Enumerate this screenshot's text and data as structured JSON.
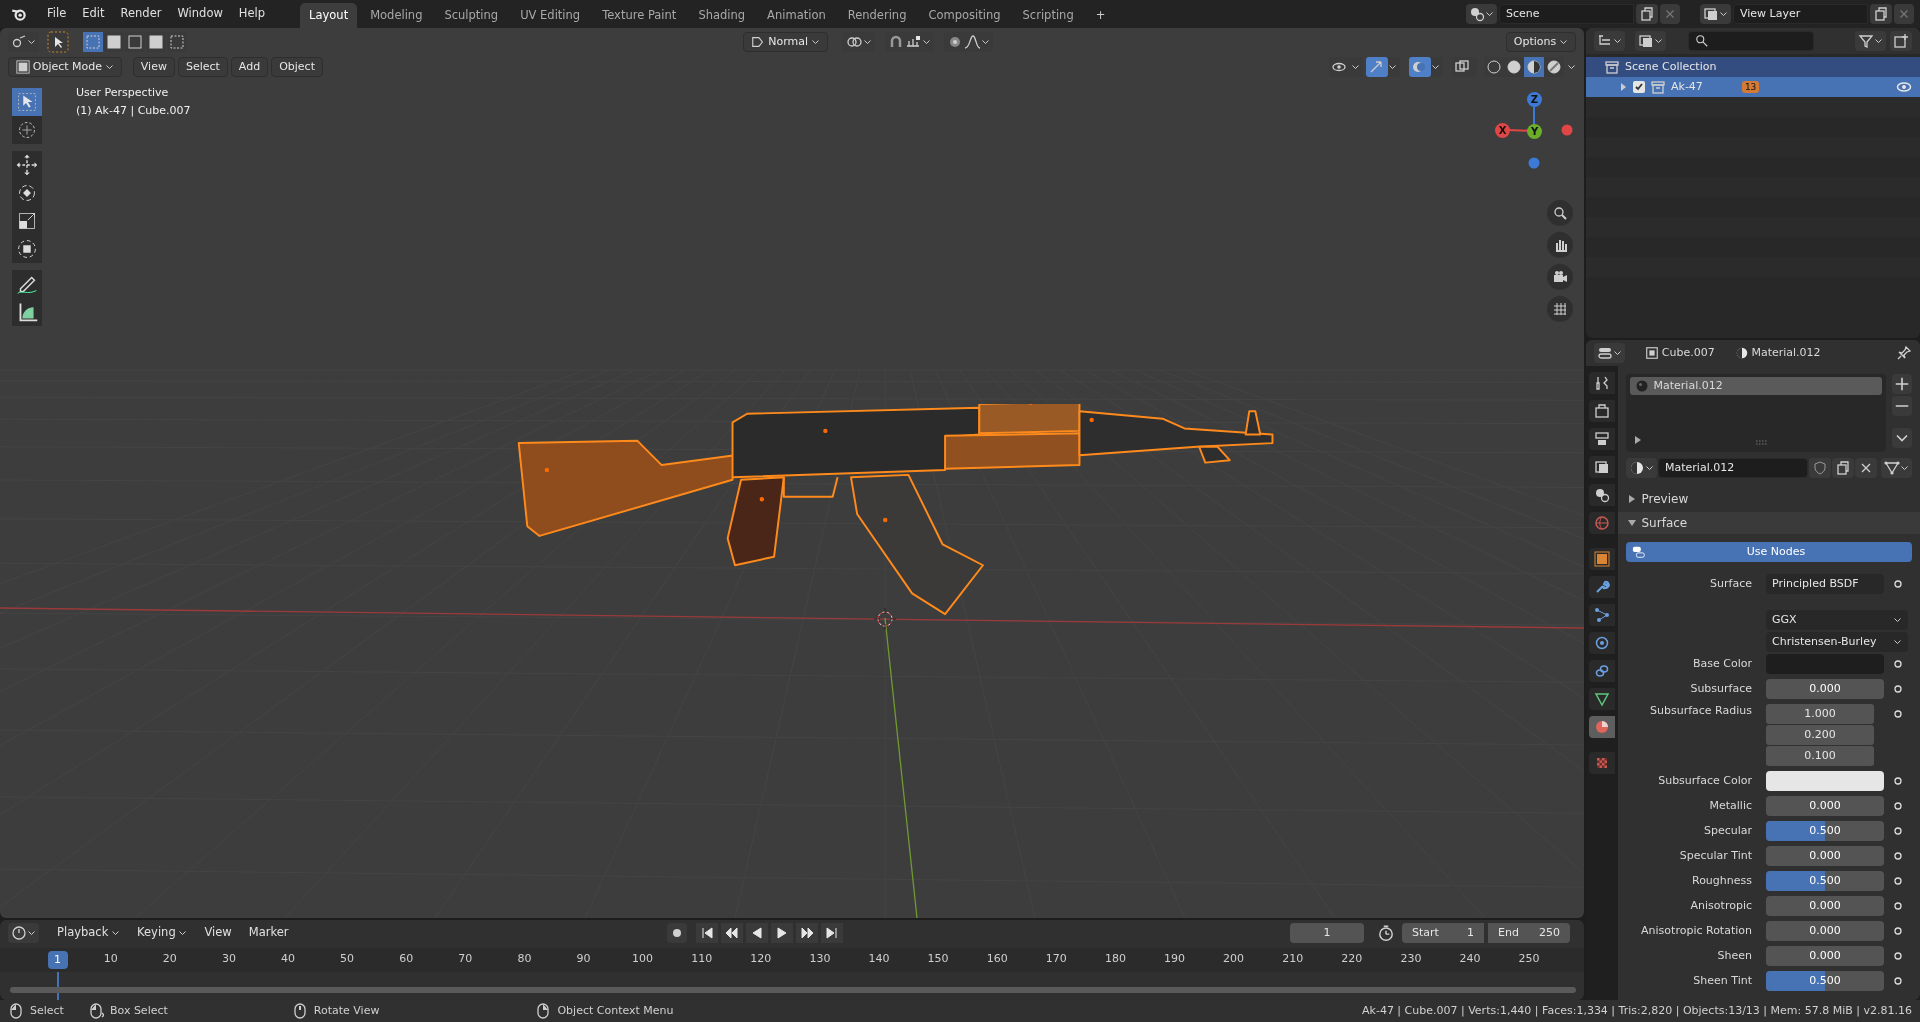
{
  "top_bar": {
    "menus": [
      "File",
      "Edit",
      "Render",
      "Window",
      "Help"
    ],
    "workspaces": [
      {
        "label": "Layout",
        "selected": true
      },
      {
        "label": "Modeling",
        "selected": false
      },
      {
        "label": "Sculpting",
        "selected": false
      },
      {
        "label": "UV Editing",
        "selected": false
      },
      {
        "label": "Texture Paint",
        "selected": false
      },
      {
        "label": "Shading",
        "selected": false
      },
      {
        "label": "Animation",
        "selected": false
      },
      {
        "label": "Rendering",
        "selected": false
      },
      {
        "label": "Compositing",
        "selected": false
      },
      {
        "label": "Scripting",
        "selected": false
      }
    ],
    "add_workspace": "+",
    "scene": "Scene",
    "view_layer": "View Layer"
  },
  "viewport": {
    "mode": "Object Mode",
    "menus": [
      "View",
      "Select",
      "Add",
      "Object"
    ],
    "orientation": "Normal",
    "options": "Options",
    "overlay": [
      "User Perspective",
      "(1) Ak-47 | Cube.007"
    ],
    "select_modes": [
      {
        "selected": true
      },
      {
        "selected": false
      },
      {
        "selected": false
      },
      {
        "selected": false
      },
      {
        "selected": false
      }
    ],
    "toggles": [
      {
        "on": false
      },
      {
        "on": true
      },
      {
        "on": true
      },
      {
        "on": false
      }
    ],
    "shading": [
      {
        "selected": false
      },
      {
        "selected": false
      },
      {
        "selected": true
      },
      {
        "selected": false
      }
    ],
    "tools": [
      {
        "selected": true
      },
      {
        "selected": false
      },
      {
        "selected": false
      },
      {
        "selected": false
      },
      {
        "selected": false
      },
      {
        "selected": false
      },
      {
        "selected": false
      },
      {
        "selected": false
      }
    ],
    "gizmo": [
      "X",
      "Y",
      "Z"
    ]
  },
  "outliner": {
    "items": [
      {
        "label": "Scene Collection",
        "active": true,
        "selected": false,
        "children": [
          {
            "label": "Ak-47",
            "selected": true,
            "checked": true,
            "expanded": false,
            "badge": "13"
          }
        ]
      }
    ]
  },
  "properties": {
    "object": "Cube.007",
    "material": "Material.012",
    "tabs": [
      {
        "selected": false
      },
      {
        "selected": false
      },
      {
        "selected": false
      },
      {
        "selected": false
      },
      {
        "selected": false
      },
      {
        "selected": false
      },
      {
        "selected": false
      },
      {
        "selected": false
      },
      {
        "selected": false
      },
      {
        "selected": false
      },
      {
        "selected": false
      },
      {
        "selected": false
      },
      {
        "selected": true
      },
      {
        "selected": false
      }
    ],
    "slots": [
      {
        "label": "Material.012",
        "selected": true
      }
    ],
    "material_field": "Material.012",
    "panels": [
      {
        "label": "Preview",
        "expanded": false
      },
      {
        "label": "Surface",
        "expanded": true
      }
    ],
    "use_nodes": "Use Nodes",
    "rows": [
      {
        "kind": "link",
        "label": "Surface",
        "value": "Principled BSDF"
      },
      {
        "kind": "dropdown",
        "value": "GGX"
      },
      {
        "kind": "dropdown",
        "value": "Christensen-Burley"
      },
      {
        "kind": "color",
        "label": "Base Color",
        "color": "#1e1e1e"
      },
      {
        "kind": "slider",
        "label": "Subsurface",
        "value": "0.000",
        "level": 0
      },
      {
        "kind": "vector",
        "label": "Subsurface Radius",
        "values": [
          "1.000",
          "0.200",
          "0.100"
        ]
      },
      {
        "kind": "color",
        "label": "Subsurface Color",
        "color": "#e6e6e6"
      },
      {
        "kind": "slider",
        "label": "Metallic",
        "value": "0.000",
        "level": 0
      },
      {
        "kind": "slider",
        "label": "Specular",
        "value": "0.500",
        "level": 0.5
      },
      {
        "kind": "slider",
        "label": "Specular Tint",
        "value": "0.000",
        "level": 0
      },
      {
        "kind": "slider",
        "label": "Roughness",
        "value": "0.500",
        "level": 0.5
      },
      {
        "kind": "slider",
        "label": "Anisotropic",
        "value": "0.000",
        "level": 0
      },
      {
        "kind": "slider",
        "label": "Anisotropic Rotation",
        "value": "0.000",
        "level": 0
      },
      {
        "kind": "slider",
        "label": "Sheen",
        "value": "0.000",
        "level": 0
      },
      {
        "kind": "slider",
        "label": "Sheen Tint",
        "value": "0.500",
        "level": 0.5
      }
    ]
  },
  "timeline": {
    "menus": [
      "Playback",
      "Keying",
      "View",
      "Marker"
    ],
    "current_frame": "1",
    "start_label": "Start",
    "start": "1",
    "end_label": "End",
    "end": "250",
    "ticks": [
      {
        "label": "1",
        "selected": true
      },
      {
        "label": "10",
        "selected": false
      },
      {
        "label": "20",
        "selected": false
      },
      {
        "label": "30",
        "selected": false
      },
      {
        "label": "40",
        "selected": false
      },
      {
        "label": "50",
        "selected": false
      },
      {
        "label": "60",
        "selected": false
      },
      {
        "label": "70",
        "selected": false
      },
      {
        "label": "80",
        "selected": false
      },
      {
        "label": "90",
        "selected": false
      },
      {
        "label": "100",
        "selected": false
      },
      {
        "label": "110",
        "selected": false
      },
      {
        "label": "120",
        "selected": false
      },
      {
        "label": "130",
        "selected": false
      },
      {
        "label": "140",
        "selected": false
      },
      {
        "label": "150",
        "selected": false
      },
      {
        "label": "160",
        "selected": false
      },
      {
        "label": "170",
        "selected": false
      },
      {
        "label": "180",
        "selected": false
      },
      {
        "label": "190",
        "selected": false
      },
      {
        "label": "200",
        "selected": false
      },
      {
        "label": "210",
        "selected": false
      },
      {
        "label": "220",
        "selected": false
      },
      {
        "label": "230",
        "selected": false
      },
      {
        "label": "240",
        "selected": false
      },
      {
        "label": "250",
        "selected": false
      }
    ]
  },
  "status_bar": {
    "hints": [
      "Select",
      "Box Select",
      "Rotate View",
      "Object Context Menu"
    ],
    "stats": "Ak-47 | Cube.007 | Verts:1,440 | Faces:1,334 | Tris:2,820 | Objects:13/13 | Mem: 57.8 MiB | v2.81.16"
  }
}
